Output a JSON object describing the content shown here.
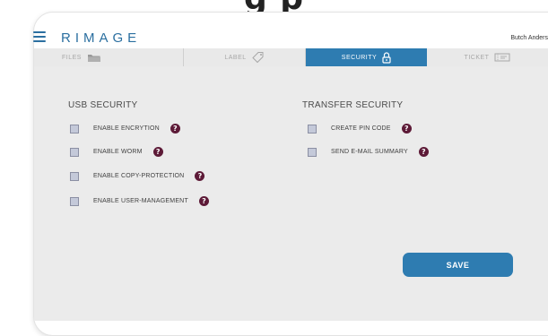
{
  "top_text": "g p",
  "app": {
    "logo": "RIMAGE",
    "user": "Butch Anders"
  },
  "tabs": [
    {
      "label": "FILES",
      "icon": "folder-icon",
      "active": false
    },
    {
      "label": "LABEL",
      "icon": "tag-icon",
      "active": false
    },
    {
      "label": "SECURITY",
      "icon": "lock-icon",
      "active": true
    },
    {
      "label": "TICKET",
      "icon": "ticket-icon",
      "active": false
    }
  ],
  "usb_security": {
    "title": "USB SECURITY",
    "options": [
      {
        "label": "ENABLE ENCRYTION",
        "checked": false
      },
      {
        "label": "ENABLE WORM",
        "checked": false
      },
      {
        "label": "ENABLE COPY-PROTECTION",
        "checked": false
      },
      {
        "label": "ENABLE USER-MANAGEMENT",
        "checked": false
      }
    ]
  },
  "transfer_security": {
    "title": "TRANSFER SECURITY",
    "options": [
      {
        "label": "CREATE PIN CODE",
        "checked": false
      },
      {
        "label": "SEND E-MAIL SUMMARY",
        "checked": false
      }
    ]
  },
  "help_glyph": "?",
  "save_label": "SAVE",
  "colors": {
    "accent": "#2e7cb1",
    "help": "#5d1a37",
    "checkbox": "#c4c9d9"
  }
}
